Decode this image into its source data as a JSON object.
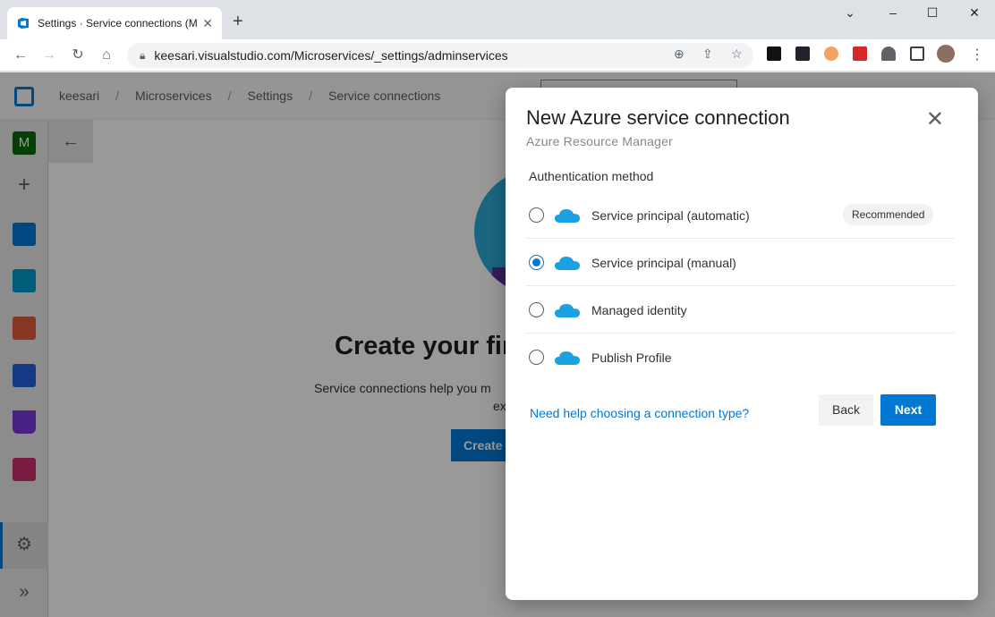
{
  "browser": {
    "tab_title": "Settings · Service connections (M",
    "url": "keesari.visualstudio.com/Microservices/_settings/adminservices",
    "new_tab": "+",
    "tab_close": "✕",
    "window": {
      "minimize": "–",
      "maximize": "☐",
      "close": "✕",
      "tabs_menu": "⌄"
    }
  },
  "header": {
    "breadcrumbs": [
      "keesari",
      "Microservices",
      "Settings",
      "Service connections"
    ],
    "separator": "/"
  },
  "sidebar": {
    "project_initial": "M",
    "add": "+",
    "settings": "⚙",
    "expand": "»"
  },
  "background": {
    "back_arrow": "←",
    "title": "Create your fir",
    "description": "Service connections help you m",
    "description2": "ex",
    "button": "Create"
  },
  "dialog": {
    "title": "New Azure service connection",
    "subtitle": "Azure Resource Manager",
    "close": "✕",
    "auth_label": "Authentication method",
    "options": [
      {
        "label": "Service principal (automatic)",
        "badge": "Recommended",
        "selected": false
      },
      {
        "label": "Service principal (manual)",
        "badge": "",
        "selected": true
      },
      {
        "label": "Managed identity",
        "badge": "",
        "selected": false
      },
      {
        "label": "Publish Profile",
        "badge": "",
        "selected": false
      }
    ],
    "help_link": "Need help choosing a connection type?",
    "back_label": "Back",
    "next_label": "Next"
  },
  "colors": {
    "accent": "#0078d4",
    "cloud": "#1ba1e2"
  }
}
